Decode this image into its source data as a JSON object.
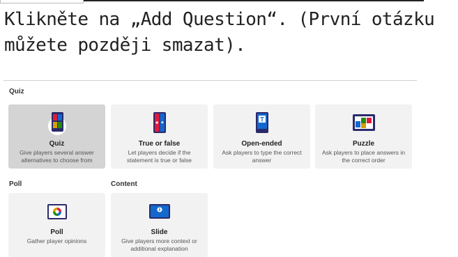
{
  "instruction": {
    "line1": "Klikněte na „Add Question“. (První otázku",
    "line2": "můžete později smazat)."
  },
  "sections": {
    "quiz": "Quiz",
    "poll": "Poll",
    "content": "Content"
  },
  "cards": {
    "quiz": {
      "title": "Quiz",
      "desc": "Give players several answer alternatives to choose from",
      "icon": "quiz-icon"
    },
    "true_false": {
      "title": "True or false",
      "desc": "Let players decide if the statement is true or false",
      "icon": "true-false-icon"
    },
    "open_ended": {
      "title": "Open-ended",
      "desc": "Ask players to type the correct answer",
      "icon": "open-ended-icon"
    },
    "puzzle": {
      "title": "Puzzle",
      "desc": "Ask players to place answers in the correct order",
      "icon": "puzzle-icon"
    },
    "poll": {
      "title": "Poll",
      "desc": "Gather player opinions",
      "icon": "poll-icon"
    },
    "slide": {
      "title": "Slide",
      "desc": "Give players more context or additional explanation",
      "icon": "slide-icon"
    }
  },
  "colors": {
    "red": "#e21b3c",
    "blue": "#1368ce",
    "yellow": "#d89e00",
    "green": "#26890c",
    "card_bg": "#f2f2f2",
    "card_selected_bg": "#d4d4d4"
  }
}
